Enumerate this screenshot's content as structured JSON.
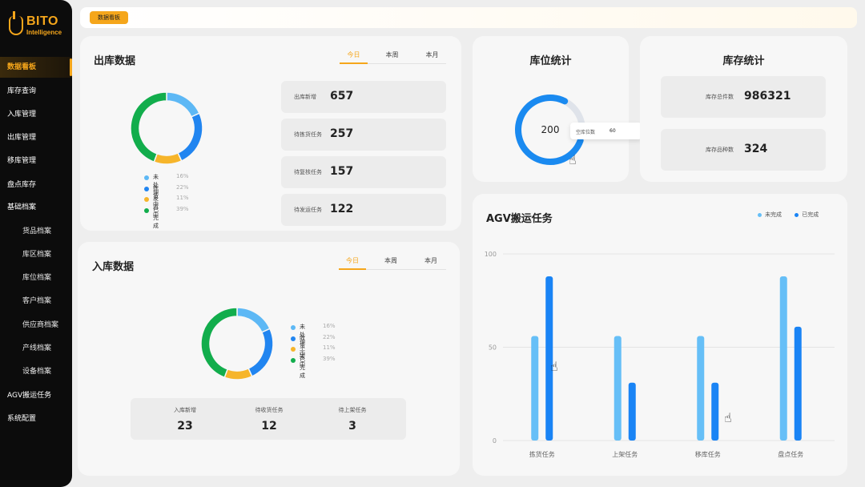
{
  "brand": {
    "name": "BITO",
    "subtitle": "Intelligence",
    "accent": "#f5a61b"
  },
  "sidebar": {
    "items": [
      {
        "label": "数据看板",
        "active": true
      },
      {
        "label": "库存查询"
      },
      {
        "label": "入库管理"
      },
      {
        "label": "出库管理"
      },
      {
        "label": "移库管理"
      },
      {
        "label": "盘点库存"
      },
      {
        "label": "基础档案",
        "expanded": true
      },
      {
        "label": "货品档案",
        "sub": true
      },
      {
        "label": "库区档案",
        "sub": true
      },
      {
        "label": "库位档案",
        "sub": true
      },
      {
        "label": "客户档案",
        "sub": true
      },
      {
        "label": "供应商档案",
        "sub": true
      },
      {
        "label": "产线档案",
        "sub": true
      },
      {
        "label": "设备档案",
        "sub": true
      },
      {
        "label": "AGV搬运任务"
      },
      {
        "label": "系统配置"
      }
    ]
  },
  "topbar": {
    "active_tab": "数据看板"
  },
  "outbound": {
    "title": "出库数据",
    "tabs": [
      "今日",
      "本周",
      "本月"
    ],
    "legend": [
      {
        "label": "未处理",
        "pct": "16%",
        "value": 16,
        "color": "#5db8f5"
      },
      {
        "label": "拣货中",
        "pct": "22%",
        "value": 22,
        "color": "#2185f0"
      },
      {
        "label": "发运中",
        "pct": "11%",
        "value": 11,
        "color": "#f6b52b"
      },
      {
        "label": "已完成",
        "pct": "39%",
        "value": 39,
        "color": "#12ad4c"
      }
    ],
    "stats": [
      {
        "label": "出库新增",
        "value": "657"
      },
      {
        "label": "待拣货任务",
        "value": "257"
      },
      {
        "label": "待复核任务",
        "value": "157"
      },
      {
        "label": "待发运任务",
        "value": "122"
      }
    ]
  },
  "inbound": {
    "title": "入库数据",
    "tabs": [
      "今日",
      "本周",
      "本月"
    ],
    "legend": [
      {
        "label": "未处理",
        "pct": "16%",
        "value": 16,
        "color": "#5db8f5"
      },
      {
        "label": "收货中",
        "pct": "22%",
        "value": 22,
        "color": "#2185f0"
      },
      {
        "label": "上架中",
        "pct": "11%",
        "value": 11,
        "color": "#f6b52b"
      },
      {
        "label": "已完成",
        "pct": "39%",
        "value": 39,
        "color": "#12ad4c"
      }
    ],
    "stats": [
      {
        "label": "入库新增",
        "value": "23"
      },
      {
        "label": "待收货任务",
        "value": "12"
      },
      {
        "label": "待上架任务",
        "value": "3"
      }
    ]
  },
  "location": {
    "title": "库位统计",
    "center_value": "200",
    "used_fraction": 0.77,
    "tooltip": {
      "label": "空库位数",
      "value": "60"
    }
  },
  "inventory": {
    "title": "库存统计",
    "items": [
      {
        "label": "库存总件数",
        "value": "986321"
      },
      {
        "label": "库存品种数",
        "value": "324"
      }
    ]
  },
  "chart_data": {
    "type": "bar",
    "title": "AGV搬运任务",
    "categories": [
      "拣货任务",
      "上架任务",
      "移库任务",
      "盘点任务"
    ],
    "series": [
      {
        "name": "未完成",
        "color": "#66bff7",
        "values": [
          56,
          56,
          56,
          88
        ]
      },
      {
        "name": "已完成",
        "color": "#1a84f5",
        "values": [
          88,
          31,
          31,
          61
        ]
      }
    ],
    "yticks": [
      "100",
      "50",
      "0"
    ],
    "ylim": [
      0,
      100
    ],
    "legend_position": "top-right",
    "grid": true
  }
}
